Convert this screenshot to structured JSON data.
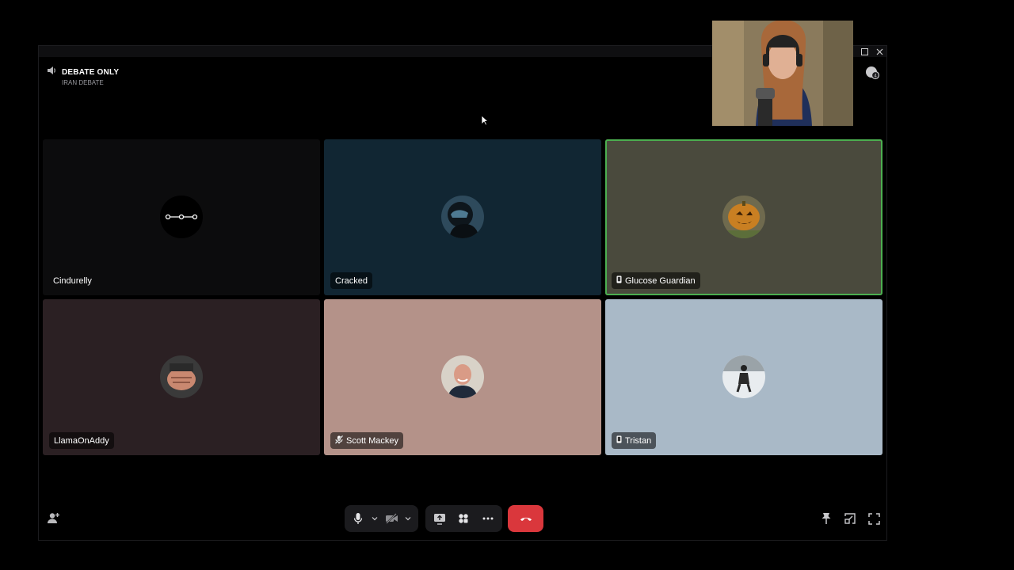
{
  "channel": {
    "name": "DEBATE ONLY",
    "subtitle": "IRAN DEBATE"
  },
  "participants": [
    {
      "name": "Cindurelly",
      "avatar": "connecting-dots-icon",
      "bg": "#0c0c0d",
      "icon": ""
    },
    {
      "name": "Cracked",
      "avatar": "helmet-avatar",
      "bg": "#112633",
      "icon": ""
    },
    {
      "name": "Glucose Guardian",
      "avatar": "pumpkin-avatar",
      "bg": "#4a4a3d",
      "icon": "mobile-icon",
      "speaking": true
    },
    {
      "name": "LlamaOnAddy",
      "avatar": "fist-avatar",
      "bg": "#2b2023",
      "icon": ""
    },
    {
      "name": "Scott Mackey",
      "avatar": "smiling-man-avatar",
      "bg": "#b49289",
      "icon": "muted-mic-icon"
    },
    {
      "name": "Tristan",
      "avatar": "snow-figure-avatar",
      "bg": "#a9b9c7",
      "icon": "mobile-icon"
    }
  ],
  "colors": {
    "speaking_border": "#4caf50",
    "end_call": "#da373c",
    "control_bg": "#1b1b1e"
  },
  "controls": {
    "icons": [
      "microphone-icon",
      "camera-off-icon",
      "screen-share-icon",
      "activities-icon",
      "more-icon",
      "end-call-icon",
      "pin-icon",
      "popout-icon",
      "fullscreen-icon"
    ]
  }
}
